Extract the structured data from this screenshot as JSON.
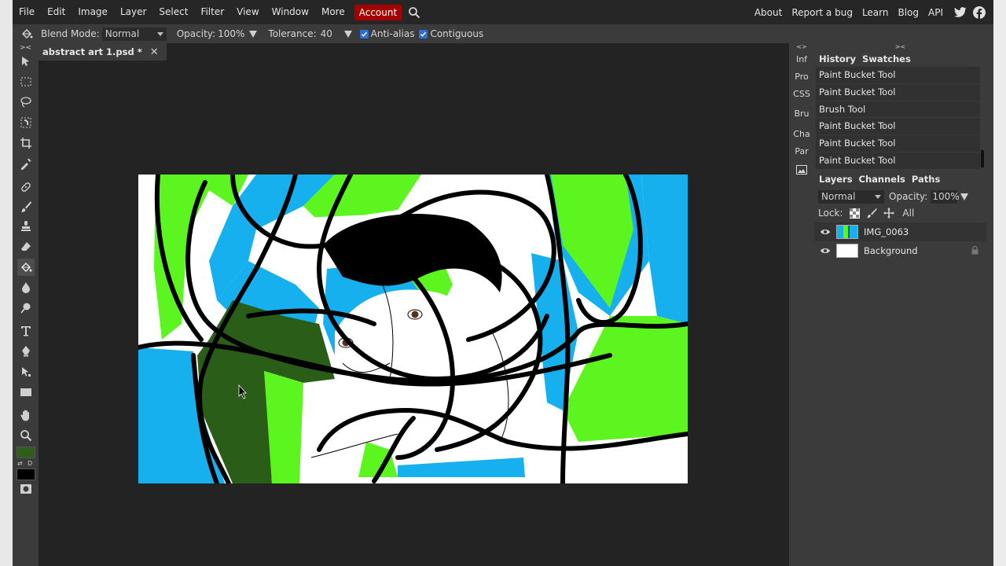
{
  "menubar": {
    "items": [
      "File",
      "Edit",
      "Image",
      "Layer",
      "Select",
      "Filter",
      "View",
      "Window",
      "More",
      "Account"
    ],
    "right_links": [
      "About",
      "Report a bug",
      "Learn",
      "Blog",
      "API"
    ],
    "search_icon": "magnifier-icon",
    "social_icons": [
      "twitter-icon",
      "facebook-icon"
    ]
  },
  "options": {
    "blend_mode_label": "Blend Mode:",
    "blend_mode_value": "Normal",
    "opacity_label": "Opacity:",
    "opacity_value": "100%",
    "tolerance_label": "Tolerance:",
    "tolerance_value": "40",
    "antialias_label": "Anti-alias",
    "antialias_checked": true,
    "contiguous_label": "Contiguous",
    "contiguous_checked": true
  },
  "toolbar": {
    "collapse_label": "><",
    "active_tool": "paint-bucket",
    "foreground_color": "#2e5e1a",
    "background_color": "#000000"
  },
  "document": {
    "tab_title": "abstract art 1.psd *",
    "close_glyph": "✕"
  },
  "side_strip": {
    "collapse_label": "<>",
    "items": [
      "Inf",
      "Pro",
      "CSS",
      "Bru",
      "Cha",
      "Par"
    ]
  },
  "panel": {
    "collapse_label": "><",
    "history_tabs": [
      "History",
      "Swatches"
    ],
    "history_items": [
      "Paint Bucket Tool",
      "Paint Bucket Tool",
      "Brush Tool",
      "Paint Bucket Tool",
      "Paint Bucket Tool",
      "Paint Bucket Tool"
    ],
    "layers_tabs": [
      "Layers",
      "Channels",
      "Paths"
    ],
    "blend_mode": "Normal",
    "opacity_label": "Opacity:",
    "opacity_value": "100%",
    "lock_label": "Lock:",
    "lock_all": "All",
    "layers": [
      {
        "name": "IMG_0063",
        "visible": true,
        "locked": false
      },
      {
        "name": "Background",
        "visible": true,
        "locked": true
      }
    ]
  },
  "colors": {
    "accent_account": "#a40000",
    "checkbox_blue": "#2d6fd6",
    "art_green": "#5cf51f",
    "art_blue": "#16b0ef",
    "art_dark_green": "#2a5e18"
  }
}
